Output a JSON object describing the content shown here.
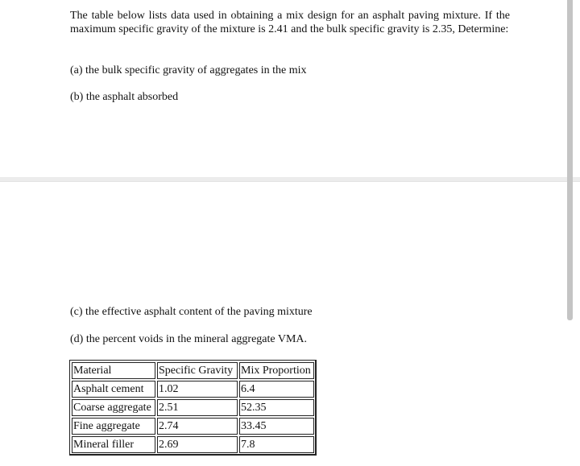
{
  "document": {
    "intro": "The table below lists data used in obtaining a mix design for an asphalt paving mixture. If the maximum specific gravity of the mixture is 2.41 and the bulk specific gravity is 2.35, Determine:",
    "questions": [
      "(a) the bulk specific gravity of aggregates in the mix",
      "(b) the asphalt absorbed",
      "(c) the effective asphalt content of the paving mixture",
      "(d) the percent voids in the mineral aggregate VMA."
    ],
    "table": {
      "headers": [
        "Material",
        "Specific Gravity",
        "Mix Proportion"
      ],
      "rows": [
        [
          "Asphalt cement",
          "1.02",
          "6.4"
        ],
        [
          "Coarse aggregate",
          "2.51",
          "52.35"
        ],
        [
          "Fine aggregate",
          "2.74",
          "33.45"
        ],
        [
          "Mineral filler",
          "2.69",
          "7.8"
        ]
      ]
    }
  }
}
